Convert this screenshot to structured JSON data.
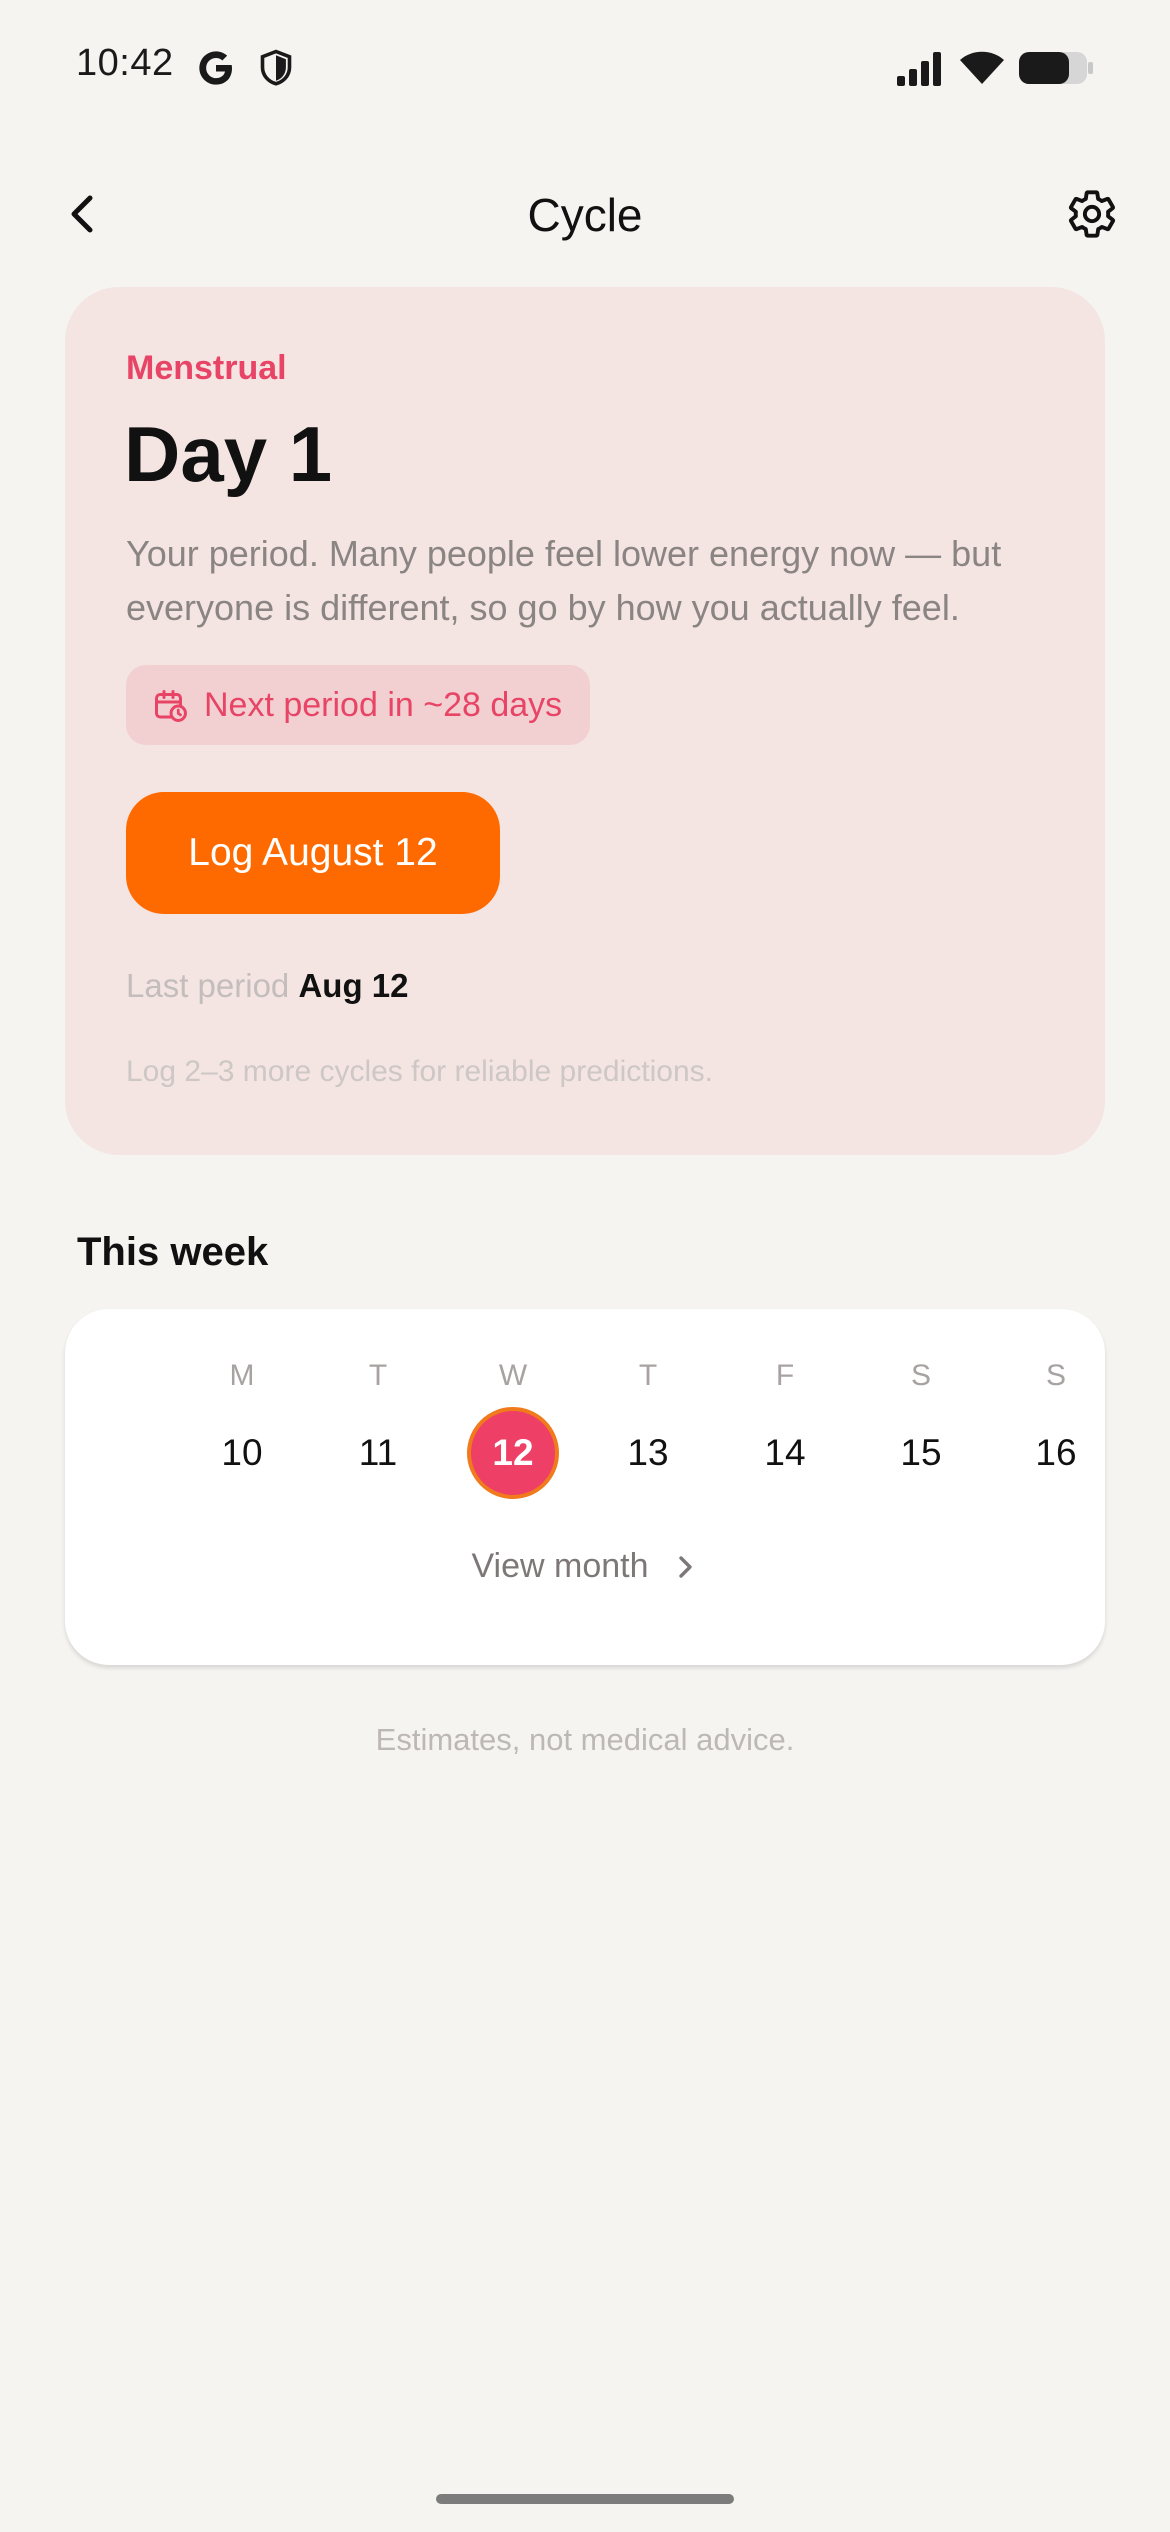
{
  "status_bar": {
    "time": "10:42",
    "icons": [
      "google-icon",
      "shield-icon",
      "signal-icon",
      "wifi-icon",
      "battery-icon"
    ]
  },
  "app_bar": {
    "title": "Cycle",
    "back_icon": "chevron-left-icon",
    "settings_icon": "gear-icon"
  },
  "phase_card": {
    "phase": "Menstrual",
    "day_title": "Day 1",
    "description": "Your period. Many people feel lower energy now — but everyone is different, so go by how you actually feel.",
    "next_period": "Next period in ~28 days",
    "log_button": "Log August 12",
    "last_period_label": "Last period",
    "last_period_value": "Aug 12",
    "hint": "Log 2–3 more cycles for reliable predictions."
  },
  "week": {
    "title": "This week",
    "days": [
      {
        "letter": "M",
        "number": "10",
        "selected": false
      },
      {
        "letter": "T",
        "number": "11",
        "selected": false
      },
      {
        "letter": "W",
        "number": "12",
        "selected": true
      },
      {
        "letter": "T",
        "number": "13",
        "selected": false
      },
      {
        "letter": "F",
        "number": "14",
        "selected": false
      },
      {
        "letter": "S",
        "number": "15",
        "selected": false
      },
      {
        "letter": "S",
        "number": "16",
        "selected": false
      }
    ],
    "view_month": "View month"
  },
  "disclaimer": "Estimates, not medical advice.",
  "colors": {
    "accent": "#ff6a00",
    "phase": "#e84465",
    "selected_day": "#ee3f67",
    "card_bg": "#f4e5e3",
    "page_bg": "#f5f4f1"
  }
}
